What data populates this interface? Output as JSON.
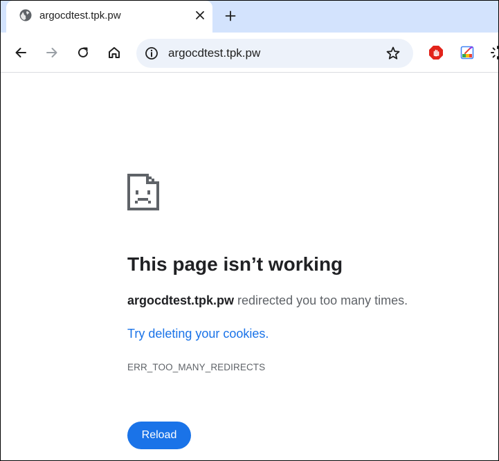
{
  "tab": {
    "title": "argocdtest.tpk.pw",
    "favicon": "globe-icon"
  },
  "toolbar": {
    "url": "argocdtest.tpk.pw",
    "site_info_icon": "info-icon",
    "bookmark_icon": "star-icon",
    "extensions": [
      "adblock-icon",
      "color-picker-icon",
      "loading-spinner-icon"
    ]
  },
  "error": {
    "icon": "sad-page-icon",
    "title": "This page isn’t working",
    "host": "argocdtest.tpk.pw",
    "message": " redirected you too many times.",
    "suggestion": "Try deleting your cookies.",
    "code": "ERR_TOO_MANY_REDIRECTS",
    "reload_label": "Reload"
  },
  "colors": {
    "tabstrip": "#d3e3fd",
    "omnibox": "#edf2fa",
    "link": "#1a73e8",
    "button": "#1a73e8",
    "title": "#202124",
    "text": "#5f6368"
  }
}
